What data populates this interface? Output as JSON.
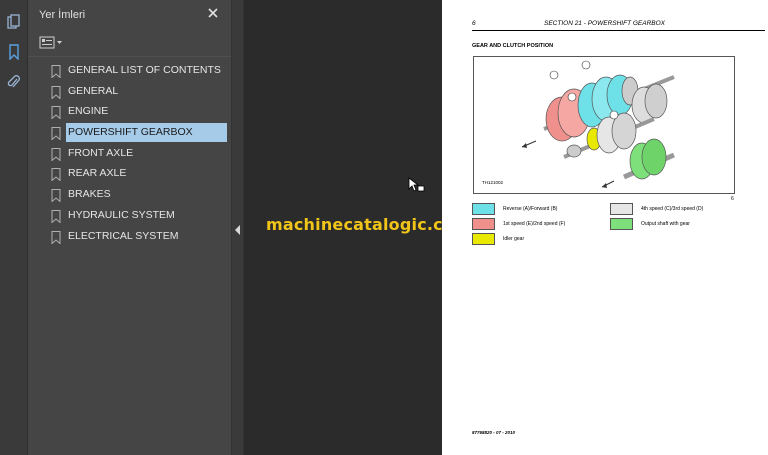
{
  "sidebar": {
    "title": "Yer İmleri",
    "close_icon": "close-icon",
    "options_icon": "list-options-icon",
    "bookmarks": [
      {
        "label": "GENERAL LIST OF CONTENTS",
        "active": false
      },
      {
        "label": "GENERAL",
        "active": false
      },
      {
        "label": "ENGINE",
        "active": false
      },
      {
        "label": "POWERSHIFT GEARBOX",
        "active": true
      },
      {
        "label": "FRONT AXLE",
        "active": false
      },
      {
        "label": "REAR AXLE",
        "active": false
      },
      {
        "label": "BRAKES",
        "active": false
      },
      {
        "label": "HYDRAULIC SYSTEM",
        "active": false
      },
      {
        "label": "ELECTRICAL SYSTEM",
        "active": false
      }
    ]
  },
  "rail": {
    "icons": [
      "pages-icon",
      "bookmark-icon",
      "attachment-icon"
    ]
  },
  "watermark": "machinecatalogic.com",
  "page": {
    "page_number": "6",
    "section_title": "SECTION 21 - POWERSHIFT GEARBOX",
    "figure_caption": "GEAR AND CLUTCH POSITION",
    "figure_code": "TH121002",
    "figure_ref": "6",
    "legend": [
      {
        "label": "Reverse (A)/Forward (B)",
        "color": "#6ee0e8"
      },
      {
        "label": "4th speed (C)/3rd speed (D)",
        "color": "#e6e6e6"
      },
      {
        "label": "1st speed (E)/2nd speed (F)",
        "color": "#f0908c"
      },
      {
        "label": "Output shaft with gear",
        "color": "#7ee07a"
      },
      {
        "label": "Idler gear",
        "color": "#e8e800"
      }
    ],
    "footer": "87768820 - 07 - 2010"
  }
}
